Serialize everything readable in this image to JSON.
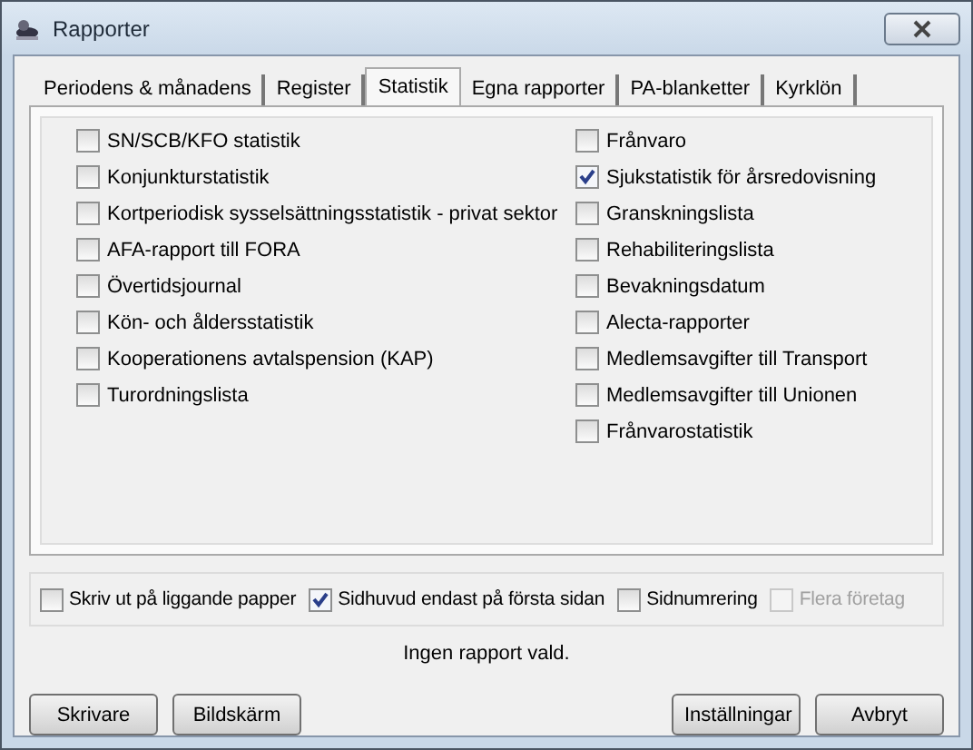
{
  "window": {
    "title": "Rapporter"
  },
  "tabs": [
    {
      "label": "Periodens & månadens",
      "selected": false
    },
    {
      "label": "Register",
      "selected": false
    },
    {
      "label": "Statistik",
      "selected": true
    },
    {
      "label": "Egna rapporter",
      "selected": false
    },
    {
      "label": "PA-blanketter",
      "selected": false
    },
    {
      "label": "Kyrklön",
      "selected": false
    }
  ],
  "reports_left": [
    {
      "label": "SN/SCB/KFO statistik",
      "checked": false
    },
    {
      "label": "Konjunkturstatistik",
      "checked": false
    },
    {
      "label": "Kortperiodisk sysselsättningsstatistik - privat sektor",
      "checked": false
    },
    {
      "label": "AFA-rapport till FORA",
      "checked": false
    },
    {
      "label": "Övertidsjournal",
      "checked": false
    },
    {
      "label": "Kön- och åldersstatistik",
      "checked": false
    },
    {
      "label": "Kooperationens avtalspension (KAP)",
      "checked": false
    },
    {
      "label": "Turordningslista",
      "checked": false
    }
  ],
  "reports_right": [
    {
      "label": "Frånvaro",
      "checked": false
    },
    {
      "label": "Sjukstatistik för årsredovisning",
      "checked": true
    },
    {
      "label": "Granskningslista",
      "checked": false
    },
    {
      "label": "Rehabiliteringslista",
      "checked": false
    },
    {
      "label": "Bevakningsdatum",
      "checked": false
    },
    {
      "label": "Alecta-rapporter",
      "checked": false
    },
    {
      "label": "Medlemsavgifter till Transport",
      "checked": false
    },
    {
      "label": "Medlemsavgifter till Unionen",
      "checked": false
    },
    {
      "label": "Frånvarostatistik",
      "checked": false
    }
  ],
  "options": [
    {
      "label": "Skriv ut på liggande papper",
      "checked": false,
      "disabled": false
    },
    {
      "label": "Sidhuvud endast på första sidan",
      "checked": true,
      "disabled": false
    },
    {
      "label": "Sidnumrering",
      "checked": false,
      "disabled": false
    },
    {
      "label": "Flera företag",
      "checked": false,
      "disabled": true
    }
  ],
  "status": "Ingen rapport vald.",
  "buttons_left": [
    "Skrivare",
    "Bildskärm"
  ],
  "buttons_right": [
    "Inställningar",
    "Avbryt"
  ]
}
